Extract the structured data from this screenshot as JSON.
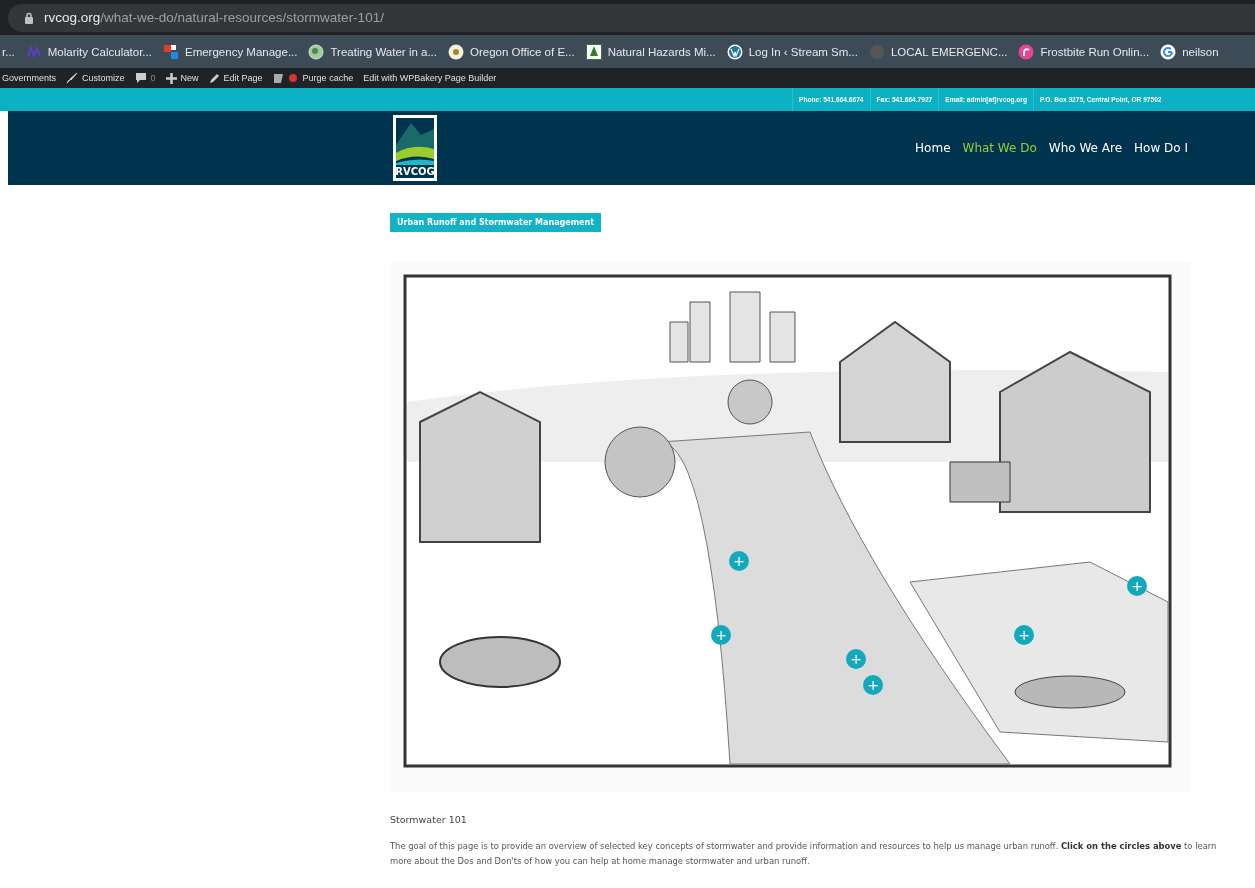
{
  "browser": {
    "url_host": "rvcog.org",
    "url_path": "/what-we-do/natural-resources/stormwater-101/"
  },
  "bookmarks": [
    "r...",
    "Molarity Calculator...",
    "Emergency Manage...",
    "Treating Water in a...",
    "Oregon Office of E...",
    "Natural Hazards Mi...",
    "Log In ‹ Stream Sm...",
    "LOCAL EMERGENC...",
    "Frostbite Run Onlin...",
    "neilson"
  ],
  "admin_bar": [
    "Governments",
    "Customize",
    "0",
    "New",
    "Edit Page",
    "Purge cache",
    "Edit with WPBakery Page Builder"
  ],
  "contact": [
    "Phone: 541.664.6674",
    "Fax: 541.664.7927",
    "Email: admin[at]rvcog.org",
    "P.O. Box 3275, Central Point, OR 97502"
  ],
  "logo": {
    "text": "RVCOG"
  },
  "nav": [
    {
      "label": "Home",
      "selected": false
    },
    {
      "label": "What We Do",
      "selected": true
    },
    {
      "label": "Who We Are",
      "selected": false
    },
    {
      "label": "How Do I",
      "selected": false
    }
  ],
  "section_tag": "Urban Runoff and Stormwater Management",
  "illustration": {
    "hotspots": [
      "+",
      "+",
      "+",
      "+",
      "+",
      "+"
    ]
  },
  "heading": "Stormwater 101",
  "paragraph": "The goal of this page is to provide an overview of selected key concepts of stormwater and provide information and resources to help us manage urban runoff.  **Click on the circles above** to learn more about the Dos and Don'ts of how you can help at home manage stormwater and urban runoff."
}
